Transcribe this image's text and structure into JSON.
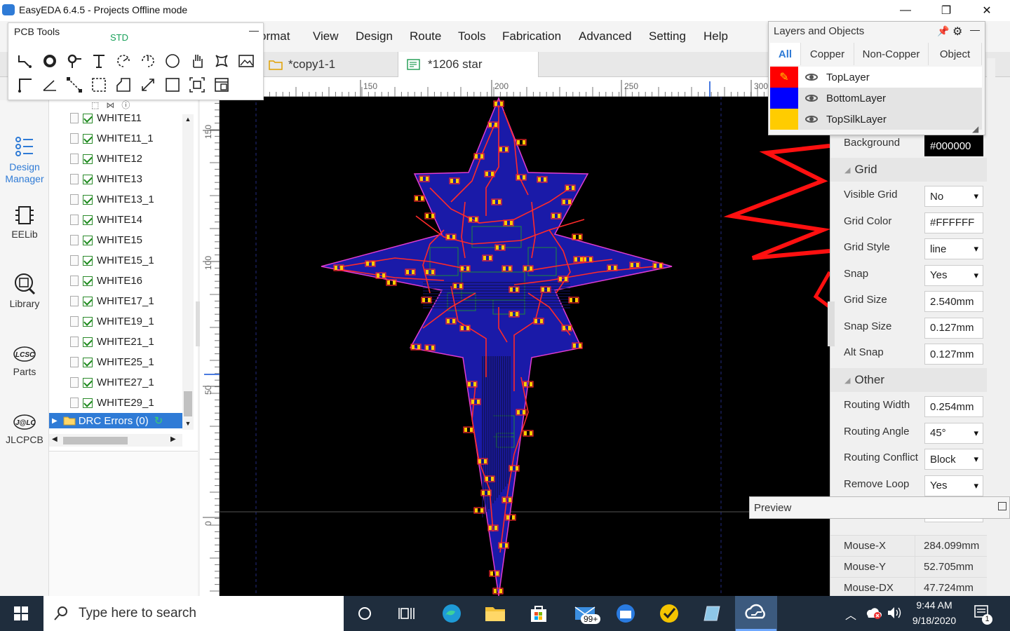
{
  "window": {
    "title": "EasyEDA 6.4.5 - Projects Offline mode",
    "minimize": "—",
    "maximize": "❐",
    "close": "✕"
  },
  "menu": [
    "Format",
    "View",
    "Design",
    "Route",
    "Tools",
    "Fabrication",
    "Advanced",
    "Setting",
    "Help"
  ],
  "menu_partial_first": "ormat",
  "tabs": [
    {
      "label": "*copy1-1",
      "active": false
    },
    {
      "label": "*1206 star",
      "active": true
    }
  ],
  "pcb_tools": {
    "title": "PCB Tools",
    "std_label": "STD",
    "collapse": "—"
  },
  "left_nav": [
    {
      "label": "Design Manager",
      "icon": "design-manager-icon"
    },
    {
      "label": "EELib",
      "icon": "chip-icon"
    },
    {
      "label": "Library",
      "icon": "library-icon"
    },
    {
      "label": "Parts",
      "icon": "lcsc-icon",
      "logo": "LCSC"
    },
    {
      "label": "JLCPCB",
      "icon": "jlc-icon",
      "logo": "J@LC"
    }
  ],
  "tree_items": [
    "WHITE11",
    "WHITE11_1",
    "WHITE12",
    "WHITE13",
    "WHITE13_1",
    "WHITE14",
    "WHITE15",
    "WHITE15_1",
    "WHITE16",
    "WHITE17_1",
    "WHITE19_1",
    "WHITE21_1",
    "WHITE25_1",
    "WHITE27_1",
    "WHITE29_1"
  ],
  "drc": "DRC Errors (0)",
  "ruler": {
    "top": [
      "150",
      "200",
      "250",
      "300"
    ],
    "left": [
      "150",
      "100",
      "50",
      "0"
    ]
  },
  "layers_panel": {
    "title": "Layers and Objects",
    "tabs": [
      "All",
      "Copper",
      "Non-Copper",
      "Object"
    ],
    "rows": [
      {
        "name": "TopLayer",
        "color": "#ff0000"
      },
      {
        "name": "BottomLayer",
        "color": "#0000ff"
      },
      {
        "name": "TopSilkLayer",
        "color": "#ffcc00"
      }
    ]
  },
  "props": {
    "background_label": "Background",
    "background_value": "#000000",
    "grid_section": "Grid",
    "rows_grid": [
      {
        "label": "Visible Grid",
        "value": "No",
        "select": true
      },
      {
        "label": "Grid Color",
        "value": "#FFFFFF",
        "select": false
      },
      {
        "label": "Grid Style",
        "value": "line",
        "select": true
      },
      {
        "label": "Snap",
        "value": "Yes",
        "select": true
      },
      {
        "label": "Grid Size",
        "value": "2.540mm",
        "select": false
      },
      {
        "label": "Snap Size",
        "value": "0.127mm",
        "select": false
      },
      {
        "label": "Alt Snap",
        "value": "0.127mm",
        "select": false
      }
    ],
    "other_section": "Other",
    "rows_other": [
      {
        "label": "Routing Width",
        "value": "0.254mm",
        "select": false
      },
      {
        "label": "Routing Angle",
        "value": "45°",
        "select": true
      },
      {
        "label": "Routing Conflict",
        "value": "Block",
        "select": true
      },
      {
        "label": "Remove Loop",
        "value": "Yes",
        "select": true
      }
    ],
    "mouse": [
      {
        "label": "Mouse-X",
        "value": "284.099mm"
      },
      {
        "label": "Mouse-Y",
        "value": "52.705mm"
      },
      {
        "label": "Mouse-DX",
        "value": "47.724mm"
      }
    ]
  },
  "preview_label": "Preview",
  "taskbar": {
    "search_placeholder": "Type here to search",
    "time": "9:44 AM",
    "date": "9/18/2020",
    "mail_badge": "99+",
    "notif_count": "1"
  },
  "colors": {
    "board": "#1a1aa8",
    "trace": "#ff2a2a",
    "outline": "#e23bd0",
    "pad": "#ffcc00",
    "accent": "#2f7bd6"
  }
}
